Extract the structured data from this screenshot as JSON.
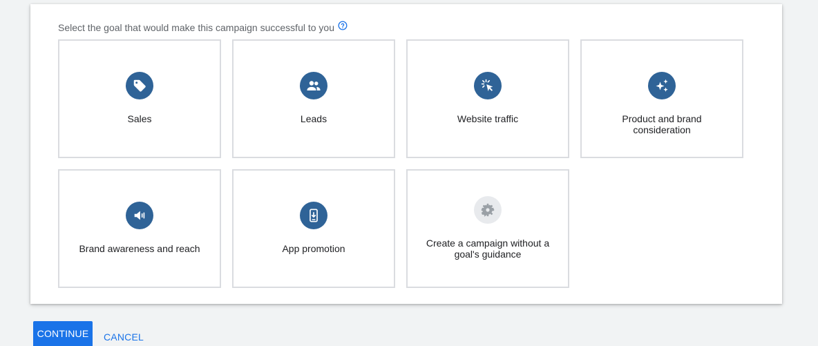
{
  "prompt": "Select the goal that would make this campaign successful to you",
  "goals": [
    {
      "label": "Sales",
      "icon": "tag-icon"
    },
    {
      "label": "Leads",
      "icon": "people-icon"
    },
    {
      "label": "Website traffic",
      "icon": "cursor-click-icon"
    },
    {
      "label": "Product and brand consideration",
      "icon": "sparkle-icon"
    },
    {
      "label": "Brand awareness and reach",
      "icon": "speaker-icon"
    },
    {
      "label": "App promotion",
      "icon": "phone-download-icon"
    },
    {
      "label": "Create a campaign without a goal's guidance",
      "icon": "gear-icon"
    }
  ],
  "actions": {
    "continue_label": "CONTINUE",
    "cancel_label": "CANCEL"
  },
  "colors": {
    "icon_bg": "#2f6397",
    "icon_bg_muted": "#e8eaed",
    "primary": "#1a73e8",
    "tile_border": "#dadce0"
  }
}
